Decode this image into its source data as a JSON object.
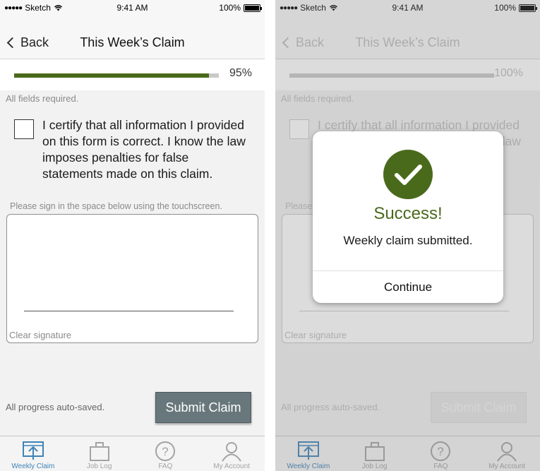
{
  "status": {
    "carrier": "Sketch",
    "time": "9:41 AM",
    "battery": "100%"
  },
  "nav": {
    "back_label": "Back",
    "title": "This Week’s Claim"
  },
  "left": {
    "progress": {
      "percent_label": "95%",
      "fraction": 0.95
    },
    "fields_note": "All fields required.",
    "certify_text": "I certify that all information I provided on this form is correct. I know the law imposes penalties for false statements made on this claim.",
    "sign_hint": "Please sign in the space below using the touchscreen.",
    "clear_signature": "Clear signature",
    "autosave": "All progress auto-saved.",
    "submit_label": "Submit Claim"
  },
  "right": {
    "progress": {
      "percent_label": "100%",
      "fraction": 1.0
    },
    "modal": {
      "title": "Success!",
      "message": "Weekly claim submitted.",
      "continue_label": "Continue"
    }
  },
  "tabs": [
    {
      "label": "Weekly Claim",
      "icon": "upload-tray-icon",
      "active": true
    },
    {
      "label": "Job Log",
      "icon": "briefcase-icon",
      "active": false
    },
    {
      "label": "FAQ",
      "icon": "question-circle-icon",
      "active": false
    },
    {
      "label": "My Account",
      "icon": "user-icon",
      "active": false
    }
  ],
  "colors": {
    "accent_green": "#4a6a1b",
    "tab_active": "#3d83b8",
    "submit_button": "#68777b"
  }
}
